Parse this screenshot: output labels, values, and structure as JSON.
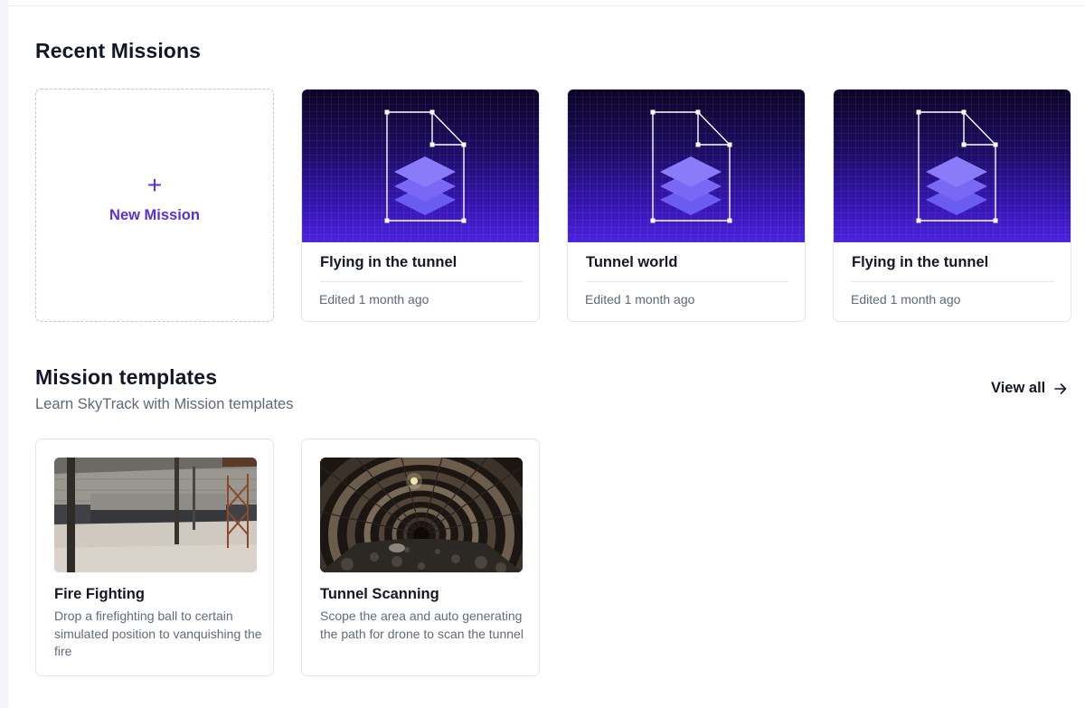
{
  "recent": {
    "title": "Recent Missions",
    "new_mission_icon": "plus-icon",
    "new_mission_label": "New Mission",
    "missions": [
      {
        "name": "Flying in the tunnel",
        "edited": "Edited 1 month ago",
        "icon": "document-layers-icon"
      },
      {
        "name": "Tunnel world",
        "edited": "Edited 1 month ago",
        "icon": "document-layers-icon"
      },
      {
        "name": "Flying in the tunnel",
        "edited": "Edited 1 month ago",
        "icon": "document-layers-icon"
      }
    ]
  },
  "templates": {
    "title": "Mission templates",
    "subtitle": "Learn SkyTrack with Mission templates",
    "view_all_label": "View all",
    "view_all_icon": "arrow-right-icon",
    "items": [
      {
        "name": "Fire Fighting",
        "description": "Drop a firefighting ball to certain simulated position to vanquishing the fire"
      },
      {
        "name": "Tunnel Scanning",
        "description": "Scope the area and auto generating the path for drone to scan the tunnel"
      }
    ]
  },
  "colors": {
    "accent": "#5a2fd6",
    "thumbnail_top": "#0c0426",
    "thumbnail_bottom": "#4a22dd",
    "layers": "#7b6ef6",
    "text_primary": "#131728",
    "text_secondary": "#5f6877",
    "card_border": "#e3e5ea"
  }
}
